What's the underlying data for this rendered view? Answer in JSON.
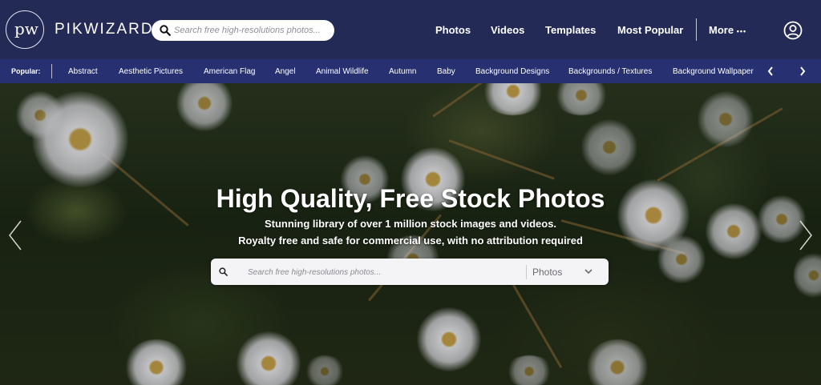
{
  "header": {
    "logo_text": "pw",
    "brand": "PIKWIZARD",
    "search_placeholder": "Search free high-resolutions photos...",
    "nav": [
      {
        "label": "Photos"
      },
      {
        "label": "Videos"
      },
      {
        "label": "Templates"
      },
      {
        "label": "Most Popular"
      }
    ],
    "more_label": "More",
    "more_dots": "•••"
  },
  "popular": {
    "label": "Popular:",
    "items": [
      "Abstract",
      "Aesthetic Pictures",
      "American Flag",
      "Angel",
      "Animal Wildlife",
      "Autumn",
      "Baby",
      "Background Designs",
      "Backgrounds / Textures",
      "Background Wallpaper"
    ]
  },
  "hero": {
    "title": "High Quality, Free Stock Photos",
    "subtitle_line1": "Stunning library of over 1 million stock images and videos.",
    "subtitle_line2": "Royalty free and safe for commercial use, with no attribution required",
    "search_placeholder": "Search free high-resolutions photos...",
    "search_type": "Photos"
  },
  "colors": {
    "header_bg": "#232a56",
    "popular_bg": "#273070",
    "text": "#ffffff"
  }
}
